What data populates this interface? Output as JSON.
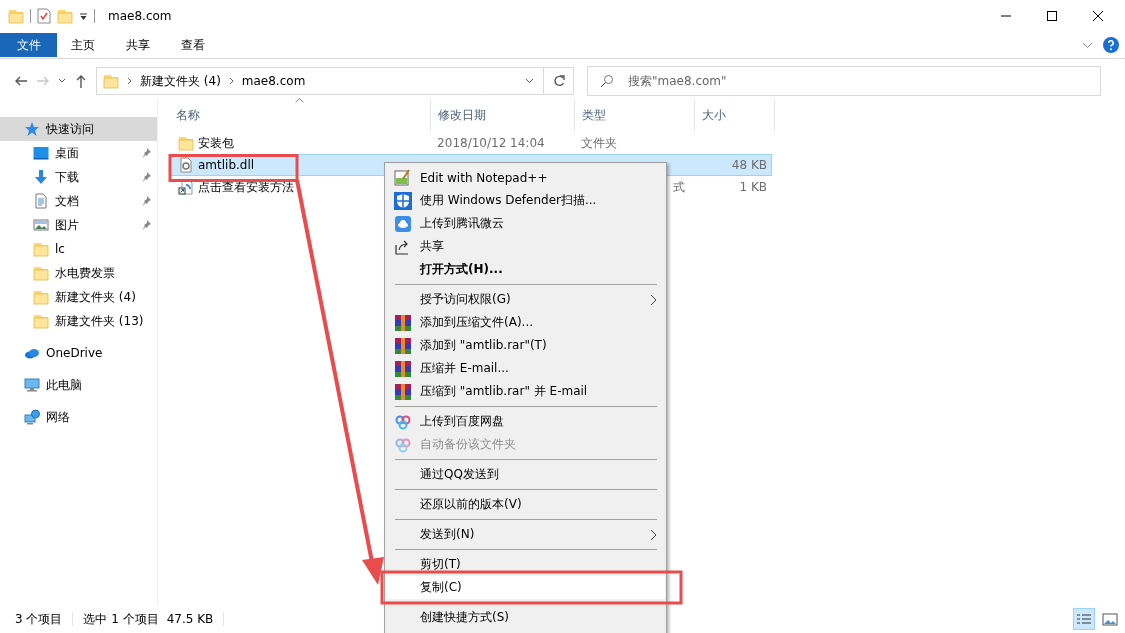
{
  "window": {
    "title": "mae8.com"
  },
  "ribbon": {
    "tabs": [
      {
        "label": "文件",
        "kind": "file"
      },
      {
        "label": "主页",
        "kind": "tab"
      },
      {
        "label": "共享",
        "kind": "tab"
      },
      {
        "label": "查看",
        "kind": "tab"
      }
    ]
  },
  "nav_buttons": [
    {
      "kind": "back",
      "disabled": false
    },
    {
      "kind": "forward",
      "disabled": true
    },
    {
      "kind": "recent",
      "disabled": false
    },
    {
      "kind": "up",
      "disabled": false
    }
  ],
  "address": {
    "crumbs": [
      "新建文件夹 (4)",
      "mae8.com"
    ]
  },
  "search": {
    "placeholder": "搜索\"mae8.com\""
  },
  "sidebar": {
    "items": [
      {
        "label": "快速访问",
        "kind": "star",
        "selected": true,
        "children": [
          {
            "label": "桌面",
            "kind": "desktop",
            "pinned": true,
            "selected": false
          },
          {
            "label": "下载",
            "kind": "download",
            "pinned": true,
            "selected": false
          },
          {
            "label": "文档",
            "kind": "document",
            "pinned": true,
            "selected": false
          },
          {
            "label": "图片",
            "kind": "picture",
            "pinned": true,
            "selected": false
          },
          {
            "label": "lc",
            "kind": "folder",
            "pinned": false,
            "selected": false
          },
          {
            "label": "水电费发票",
            "kind": "folder",
            "pinned": false,
            "selected": false
          },
          {
            "label": "新建文件夹 (4)",
            "kind": "folder",
            "pinned": false,
            "selected": false
          },
          {
            "label": "新建文件夹 (13)",
            "kind": "folder",
            "pinned": false,
            "selected": false
          }
        ]
      },
      {
        "label": "OneDrive",
        "kind": "cloud",
        "selected": false
      },
      {
        "label": "此电脑",
        "kind": "pc",
        "selected": false
      },
      {
        "label": "网络",
        "kind": "network",
        "selected": false
      }
    ]
  },
  "table": {
    "columns": [
      "名称",
      "修改日期",
      "类型",
      "大小"
    ],
    "rows": [
      {
        "name": "安装包",
        "kind": "folder",
        "date": "2018/10/12 14:04",
        "type": "文件夹",
        "selected": false,
        "covered": false
      },
      {
        "name": "amtlib.dll",
        "kind": "dll",
        "size": "48 KB",
        "selected": true,
        "covered": true
      },
      {
        "name": "点击查看安装方法",
        "kind": "shortcut",
        "type": "式",
        "size": "1 KB",
        "selected": false,
        "covered": true
      }
    ]
  },
  "context_menu": {
    "items": [
      {
        "kind": "notepad",
        "label": "Edit with Notepad++",
        "selected": false,
        "disabled": false
      },
      {
        "kind": "shield",
        "label": "使用 Windows Defender扫描...",
        "selected": false,
        "disabled": false
      },
      {
        "kind": "weiyun",
        "label": "上传到腾讯微云",
        "selected": false,
        "disabled": false
      },
      {
        "kind": "share",
        "label": "共享",
        "selected": false,
        "disabled": false
      },
      {
        "kind": "item",
        "label": "打开方式(H)...",
        "bold": true,
        "selected": false,
        "disabled": false
      },
      {
        "kind": "separator"
      },
      {
        "kind": "item",
        "label": "授予访问权限(G)",
        "submenu": true,
        "selected": false,
        "disabled": false
      },
      {
        "kind": "rar",
        "label": "添加到压缩文件(A)...",
        "selected": false,
        "disabled": false
      },
      {
        "kind": "rar",
        "label": "添加到 \"amtlib.rar\"(T)",
        "selected": false,
        "disabled": false
      },
      {
        "kind": "rar",
        "label": "压缩并 E-mail...",
        "selected": false,
        "disabled": false
      },
      {
        "kind": "rar",
        "label": "压缩到 \"amtlib.rar\" 并 E-mail",
        "selected": false,
        "disabled": false
      },
      {
        "kind": "separator"
      },
      {
        "kind": "baidu",
        "label": "上传到百度网盘",
        "selected": false,
        "disabled": false
      },
      {
        "kind": "baidu",
        "label": "自动备份该文件夹",
        "selected": false,
        "disabled": true
      },
      {
        "kind": "separator"
      },
      {
        "kind": "item",
        "label": "通过QQ发送到",
        "selected": false,
        "disabled": false
      },
      {
        "kind": "separator"
      },
      {
        "kind": "item",
        "label": "还原以前的版本(V)",
        "selected": false,
        "disabled": false
      },
      {
        "kind": "separator"
      },
      {
        "kind": "item",
        "label": "发送到(N)",
        "submenu": true,
        "selected": false,
        "disabled": false
      },
      {
        "kind": "separator"
      },
      {
        "kind": "item",
        "label": "剪切(T)",
        "selected": false,
        "disabled": false
      },
      {
        "kind": "item",
        "label": "复制(C)",
        "selected": true,
        "disabled": false
      },
      {
        "kind": "separator"
      },
      {
        "kind": "item",
        "label": "创建快捷方式(S)",
        "selected": false,
        "disabled": false
      }
    ]
  },
  "status_bar": {
    "texts": [
      "3 个项目",
      "选中 1 个项目",
      "47.5 KB"
    ],
    "view_buttons": [
      {
        "kind": "details",
        "selected": true
      },
      {
        "kind": "thumbnails",
        "selected": false
      }
    ]
  }
}
